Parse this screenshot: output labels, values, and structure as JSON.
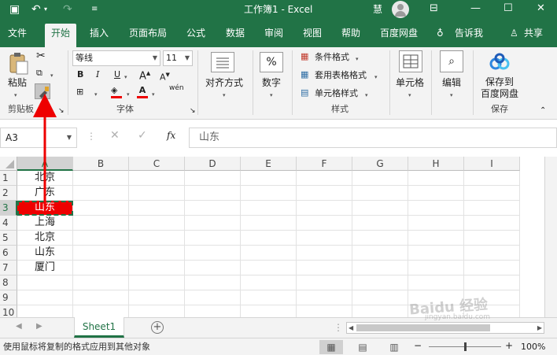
{
  "titlebar": {
    "title": "工作簿1  -  Excel",
    "user": "慧",
    "colors": {
      "brand": "#217346"
    }
  },
  "tabs": [
    "文件",
    "开始",
    "插入",
    "页面布局",
    "公式",
    "数据",
    "审阅",
    "视图",
    "帮助",
    "百度网盘",
    "告诉我",
    "共享"
  ],
  "ribbon": {
    "clipboard": {
      "paste": "粘贴",
      "group": "剪贴板"
    },
    "font": {
      "name": "等线",
      "size": "11",
      "bold": "B",
      "italic": "I",
      "underline": "U",
      "color_a": "A",
      "wen": "wén",
      "group": "字体"
    },
    "alignment": {
      "label": "对齐方式"
    },
    "number": {
      "label": "数字",
      "symbol": "%"
    },
    "styles": {
      "cond": "条件格式",
      "table": "套用表格格式",
      "cell": "单元格样式",
      "group": "样式"
    },
    "cells": {
      "label": "单元格"
    },
    "editing": {
      "label": "编辑"
    },
    "save": {
      "line1": "保存到",
      "line2": "百度网盘",
      "group": "保存"
    }
  },
  "formula_bar": {
    "name_box": "A3",
    "formula": "山东",
    "fx": "fx"
  },
  "grid": {
    "columns": [
      "A",
      "B",
      "C",
      "D",
      "E",
      "F",
      "G",
      "H",
      "I"
    ],
    "rows": [
      "1",
      "2",
      "3",
      "4",
      "5",
      "6",
      "7",
      "8",
      "9",
      "10"
    ],
    "cells": [
      "北京",
      "广东",
      "山东",
      "上海",
      "北京",
      "山东",
      "厦门",
      "",
      "",
      ""
    ],
    "selected_row": "3",
    "selected_col": "A",
    "copy_highlight": "#ee0000"
  },
  "sheets": {
    "active": "Sheet1",
    "add": "+"
  },
  "status": {
    "message": "使用鼠标将复制的格式应用到其他对象",
    "zoom": "100%",
    "zoom_level": 0.5
  },
  "watermark": {
    "line1": "Baidu 经验",
    "line2": "jingyan.baidu.com"
  }
}
